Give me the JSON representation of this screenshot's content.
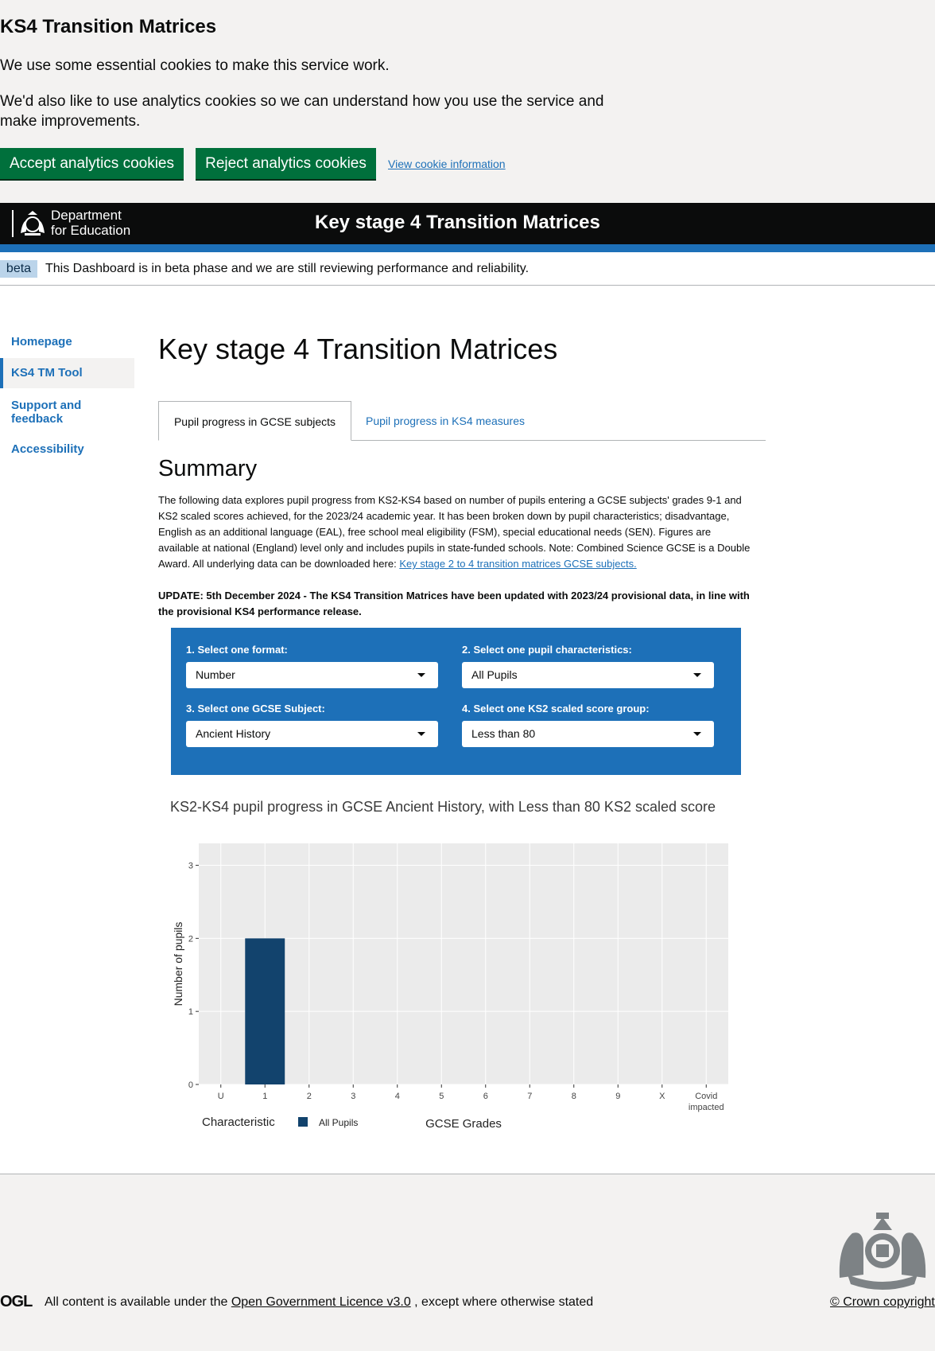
{
  "cookie_banner": {
    "title": "KS4 Transition Matrices",
    "para1": "We use some essential cookies to make this service work.",
    "para2": "We'd also like to use analytics cookies so we can understand how you use the service and make improvements.",
    "accept_label": "Accept analytics cookies",
    "reject_label": "Reject analytics cookies",
    "info_link": "View cookie information"
  },
  "header": {
    "dept_line1": "Department",
    "dept_line2": "for Education",
    "title": "Key stage 4 Transition Matrices"
  },
  "beta": {
    "tag": "beta",
    "text": "This Dashboard is in beta phase and we are still reviewing performance and reliability."
  },
  "nav": {
    "items": [
      {
        "label": "Homepage"
      },
      {
        "label": "KS4 TM Tool"
      },
      {
        "label": "Support and feedback"
      },
      {
        "label": "Accessibility"
      }
    ]
  },
  "main": {
    "title": "Key stage 4 Transition Matrices",
    "tabs": [
      {
        "label": "Pupil progress in GCSE subjects"
      },
      {
        "label": "Pupil progress in KS4 measures"
      }
    ],
    "summary_heading": "Summary",
    "summary_text": "The following data explores pupil progress from KS2-KS4 based on number of pupils entering a GCSE subjects' grades 9-1 and KS2 scaled scores achieved, for the 2023/24 academic year. It has been broken down by pupil characteristics; disadvantage, English as an additional language (EAL), free school meal eligibility (FSM), special educational needs (SEN). Figures are available at national (England) level only and includes pupils in state-funded schools. Note: Combined Science GCSE is a Double Award. All underlying data can be downloaded here: ",
    "summary_link": "Key stage 2 to 4 transition matrices GCSE subjects.",
    "update_text": "UPDATE: 5th December 2024 - The KS4 Transition Matrices have been updated with 2023/24 provisional data, in line with the provisional KS4 performance release."
  },
  "selectors": {
    "format": {
      "label": "1. Select one format:",
      "value": "Number"
    },
    "characteristic": {
      "label": "2. Select one pupil characteristics:",
      "value": "All Pupils"
    },
    "subject": {
      "label": "3. Select one GCSE Subject:",
      "value": "Ancient History"
    },
    "score_group": {
      "label": "4. Select one KS2 scaled score group:",
      "value": "Less than 80"
    }
  },
  "chart_data": {
    "type": "bar",
    "title": "KS2-KS4 pupil progress in GCSE Ancient History, with Less than 80 KS2 scaled score",
    "xlabel": "GCSE Grades",
    "ylabel": "Number of pupils",
    "categories": [
      "U",
      "1",
      "2",
      "3",
      "4",
      "5",
      "6",
      "7",
      "8",
      "9",
      "X",
      "Covid impacted"
    ],
    "series": [
      {
        "name": "All Pupils",
        "color": "#12436d",
        "values": [
          0,
          2,
          0,
          0,
          0,
          0,
          0,
          0,
          0,
          0,
          0,
          0
        ]
      }
    ],
    "ylim": [
      0,
      3.3
    ],
    "yticks": [
      0,
      1,
      2,
      3
    ],
    "legend_title": "Characteristic",
    "legend_placement": "bottom-left",
    "grid": true
  },
  "footer": {
    "ogl": "OGL",
    "licence_prefix": "All content is available under the ",
    "licence_link": "Open Government Licence v3.0",
    "licence_suffix": " , except where otherwise stated",
    "copyright": "© Crown copyright"
  }
}
